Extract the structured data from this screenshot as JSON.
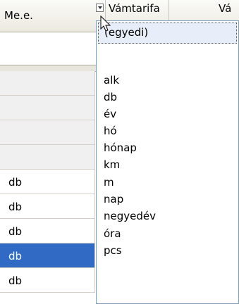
{
  "header": {
    "col_mee": "Me.e.",
    "col_vamtarifa": "Vámtarifa",
    "col_next": "Vá"
  },
  "rows": [
    {
      "value": ""
    },
    {
      "value": ""
    },
    {
      "value": ""
    },
    {
      "value": ""
    },
    {
      "value": "db"
    },
    {
      "value": "db"
    },
    {
      "value": "db"
    },
    {
      "value": "db",
      "selected": true
    },
    {
      "value": "db"
    }
  ],
  "dropdown": {
    "selected_option": "(egyedi)",
    "options": [
      "",
      "alk",
      "db",
      "év",
      "hó",
      "hónap",
      "km",
      "m",
      "nap",
      "negyedév",
      "óra",
      "pcs"
    ]
  },
  "icons": {
    "filter": "filter-dropdown-icon",
    "cursor": "mouse-pointer-icon"
  }
}
